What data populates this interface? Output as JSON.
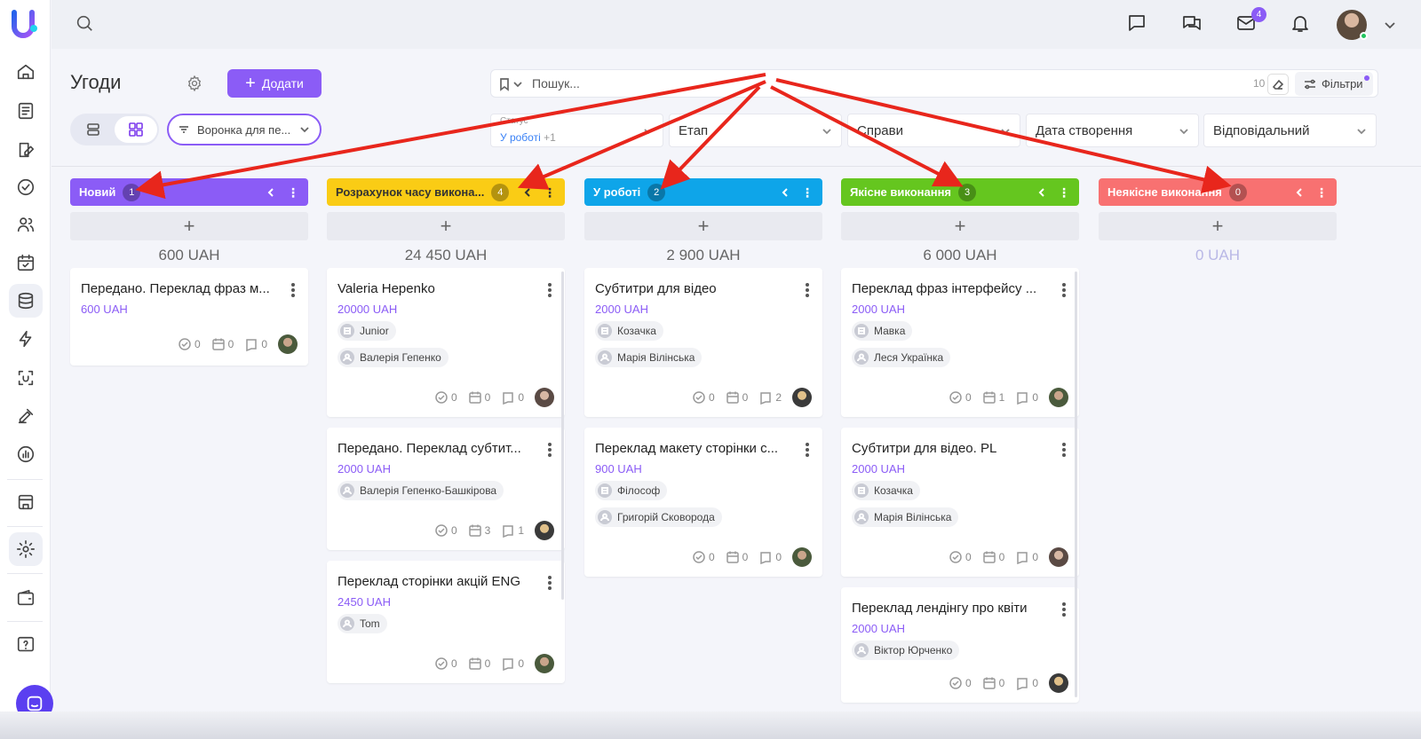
{
  "header": {
    "search_icon": "search-icon",
    "icons": [
      "chat-icon",
      "messages-icon",
      "mail-icon",
      "bell-icon"
    ],
    "mail_badge": "4"
  },
  "sidebar": {
    "icons": [
      "home-icon",
      "ledger-icon",
      "book-edit-icon",
      "check-circle-icon",
      "users-icon",
      "calendar-check-icon",
      "database-icon",
      "lightning-icon",
      "scan-icon",
      "note-edit-icon",
      "chart-icon",
      "building-icon",
      "gear-icon",
      "wallet-icon",
      "help-icon"
    ],
    "active": "database-icon"
  },
  "page": {
    "title": "Угоди",
    "add_label": "Додати",
    "funnel": "Воронка для пе..."
  },
  "search": {
    "placeholder": "Пошук...",
    "count": "10",
    "filters_label": "Фільтри"
  },
  "filters": {
    "status_label": "Статус",
    "status_value": "У роботі",
    "status_extra": "+1",
    "stage": "Етап",
    "tasks": "Справи",
    "created": "Дата створення",
    "responsible": "Відповідальний"
  },
  "columns": [
    {
      "title": "Новий",
      "count": "1",
      "sum": "600 UAH",
      "color": "#8b5cf6",
      "cards": [
        {
          "title": "Передано. Переклад фраз м...",
          "amount": "600 UAH",
          "tags": [],
          "tasks": "0",
          "events": "0",
          "notes": "0"
        }
      ]
    },
    {
      "title": "Розрахунок часу викона...",
      "count": "4",
      "sum": "24 450 UAH",
      "color": "#facc15",
      "cards": [
        {
          "title": "Valeria Hepenko",
          "amount": "20000 UAH",
          "tags": [
            "Junior",
            "Валерія Гепенко"
          ],
          "tasks": "0",
          "events": "0",
          "notes": "0"
        },
        {
          "title": "Передано. Переклад субтит...",
          "amount": "2000 UAH",
          "tags": [
            "Валерія Гепенко-Башкірова"
          ],
          "tasks": "0",
          "events": "3",
          "notes": "1"
        },
        {
          "title": "Переклад сторінки акцій ENG",
          "amount": "2450 UAH",
          "tags": [
            "Tom"
          ],
          "tasks": "0",
          "events": "0",
          "notes": "0"
        }
      ]
    },
    {
      "title": "У роботі",
      "count": "2",
      "sum": "2 900 UAH",
      "color": "#0ea5e9",
      "cards": [
        {
          "title": "Субтитри для відео",
          "amount": "2000 UAH",
          "tags": [
            "Козачка",
            "Марія Вілінська"
          ],
          "tasks": "0",
          "events": "0",
          "notes": "2"
        },
        {
          "title": "Переклад макету сторінки с...",
          "amount": "900 UAH",
          "tags": [
            "Філософ",
            "Григорій Сковорода"
          ],
          "tasks": "0",
          "events": "0",
          "notes": "0"
        }
      ]
    },
    {
      "title": "Якісне виконання",
      "count": "3",
      "sum": "6 000 UAH",
      "color": "#65c61f",
      "cards": [
        {
          "title": "Переклад фраз інтерфейсу ...",
          "amount": "2000 UAH",
          "tags": [
            "Мавка",
            "Леся Українка"
          ],
          "tasks": "0",
          "events": "1",
          "notes": "0"
        },
        {
          "title": "Субтитри для відео. PL",
          "amount": "2000 UAH",
          "tags": [
            "Козачка",
            "Марія Вілінська"
          ],
          "tasks": "0",
          "events": "0",
          "notes": "0"
        },
        {
          "title": "Переклад лендінгу про квіти",
          "amount": "2000 UAH",
          "tags": [
            "Віктор Юрченко"
          ],
          "tasks": "0",
          "events": "0",
          "notes": "0"
        }
      ]
    },
    {
      "title": "Неякісне виконання",
      "count": "0",
      "sum": "0 UAH",
      "color": "#f87171",
      "cards": []
    }
  ],
  "annotation_color": "#e8261c"
}
